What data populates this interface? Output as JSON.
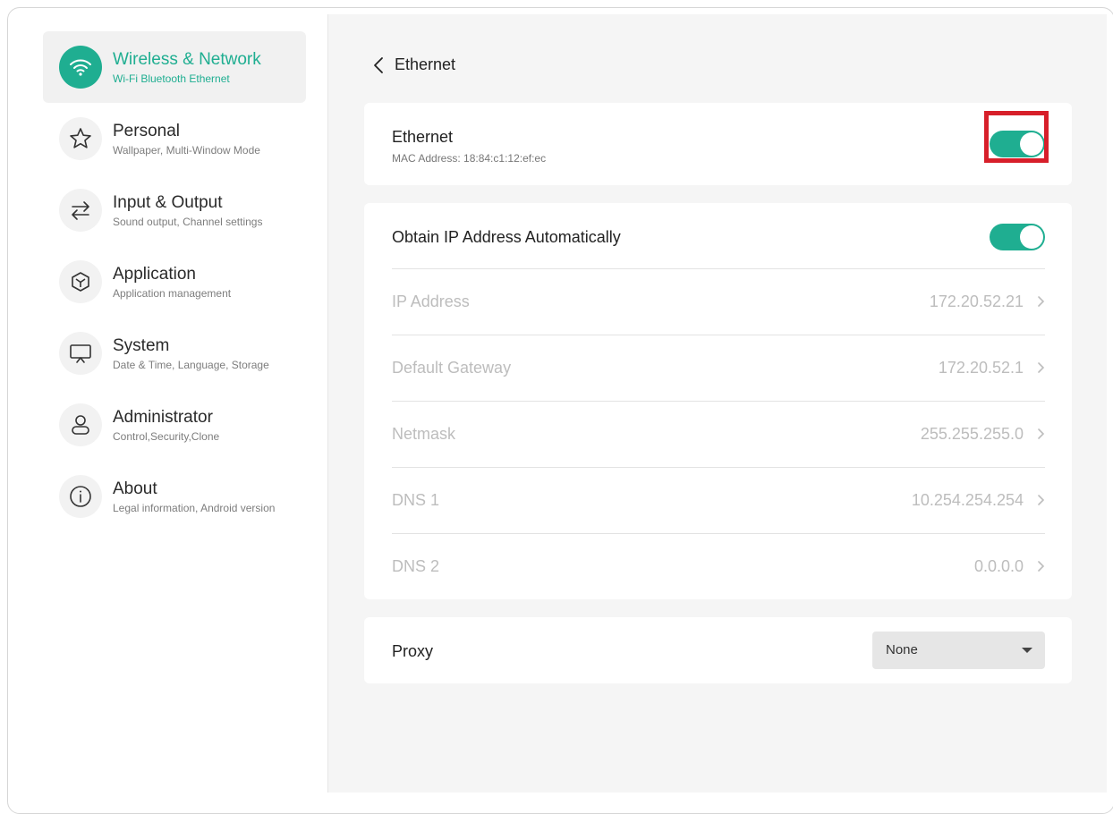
{
  "sidebar": {
    "items": [
      {
        "title": "Wireless & Network",
        "subtitle": "Wi-Fi Bluetooth Ethernet",
        "icon": "wifi-icon"
      },
      {
        "title": "Personal",
        "subtitle": "Wallpaper, Multi-Window Mode",
        "icon": "star-icon"
      },
      {
        "title": "Input & Output",
        "subtitle": "Sound output, Channel settings",
        "icon": "swap-arrows-icon"
      },
      {
        "title": "Application",
        "subtitle": "Application management",
        "icon": "cube-icon"
      },
      {
        "title": "System",
        "subtitle": "Date & Time, Language, Storage",
        "icon": "monitor-icon"
      },
      {
        "title": "Administrator",
        "subtitle": "Control,Security,Clone",
        "icon": "user-icon"
      },
      {
        "title": "About",
        "subtitle": "Legal information, Android version",
        "icon": "info-icon"
      }
    ]
  },
  "header": {
    "title": "Ethernet"
  },
  "ethernet": {
    "title": "Ethernet",
    "mac": "MAC Address: 18:84:c1:12:ef:ec",
    "enabled": true
  },
  "ip_settings": {
    "auto_label": "Obtain IP Address Automatically",
    "auto_enabled": true,
    "rows": [
      {
        "label": "IP Address",
        "value": "172.20.52.21"
      },
      {
        "label": "Default Gateway",
        "value": "172.20.52.1"
      },
      {
        "label": "Netmask",
        "value": "255.255.255.0"
      },
      {
        "label": "DNS 1",
        "value": "10.254.254.254"
      },
      {
        "label": "DNS 2",
        "value": "0.0.0.0"
      }
    ]
  },
  "proxy": {
    "label": "Proxy",
    "selected": "None"
  },
  "colors": {
    "accent": "#1fae91",
    "highlight": "#d71f2a"
  }
}
